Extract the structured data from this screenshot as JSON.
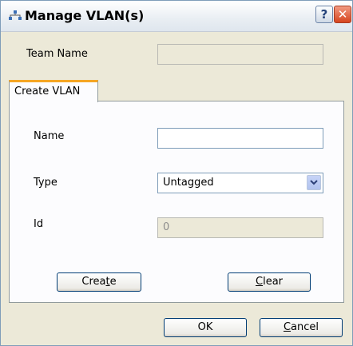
{
  "window": {
    "title": "Manage VLAN(s)"
  },
  "team": {
    "label": "Team Name",
    "value": ""
  },
  "tab": {
    "label": "Create VLAN"
  },
  "form": {
    "name": {
      "label": "Name",
      "value": ""
    },
    "type": {
      "label": "Type",
      "value": "Untagged"
    },
    "id": {
      "label": "Id",
      "value": "0"
    }
  },
  "buttons": {
    "create": {
      "pre": "Crea",
      "mnemonic": "t",
      "post": "e"
    },
    "clear": {
      "pre": "",
      "mnemonic": "C",
      "post": "lear"
    },
    "ok": {
      "label": "OK"
    },
    "cancel": {
      "pre": "",
      "mnemonic": "C",
      "post": "ancel"
    }
  },
  "icons": {
    "app": "network-icon",
    "help": "help-icon",
    "close": "close-icon",
    "dropdown": "chevron-down-icon"
  },
  "colors": {
    "tab_accent": "#f5a623",
    "close_button": "#d6441e",
    "window_bg": "#ece9d8"
  }
}
